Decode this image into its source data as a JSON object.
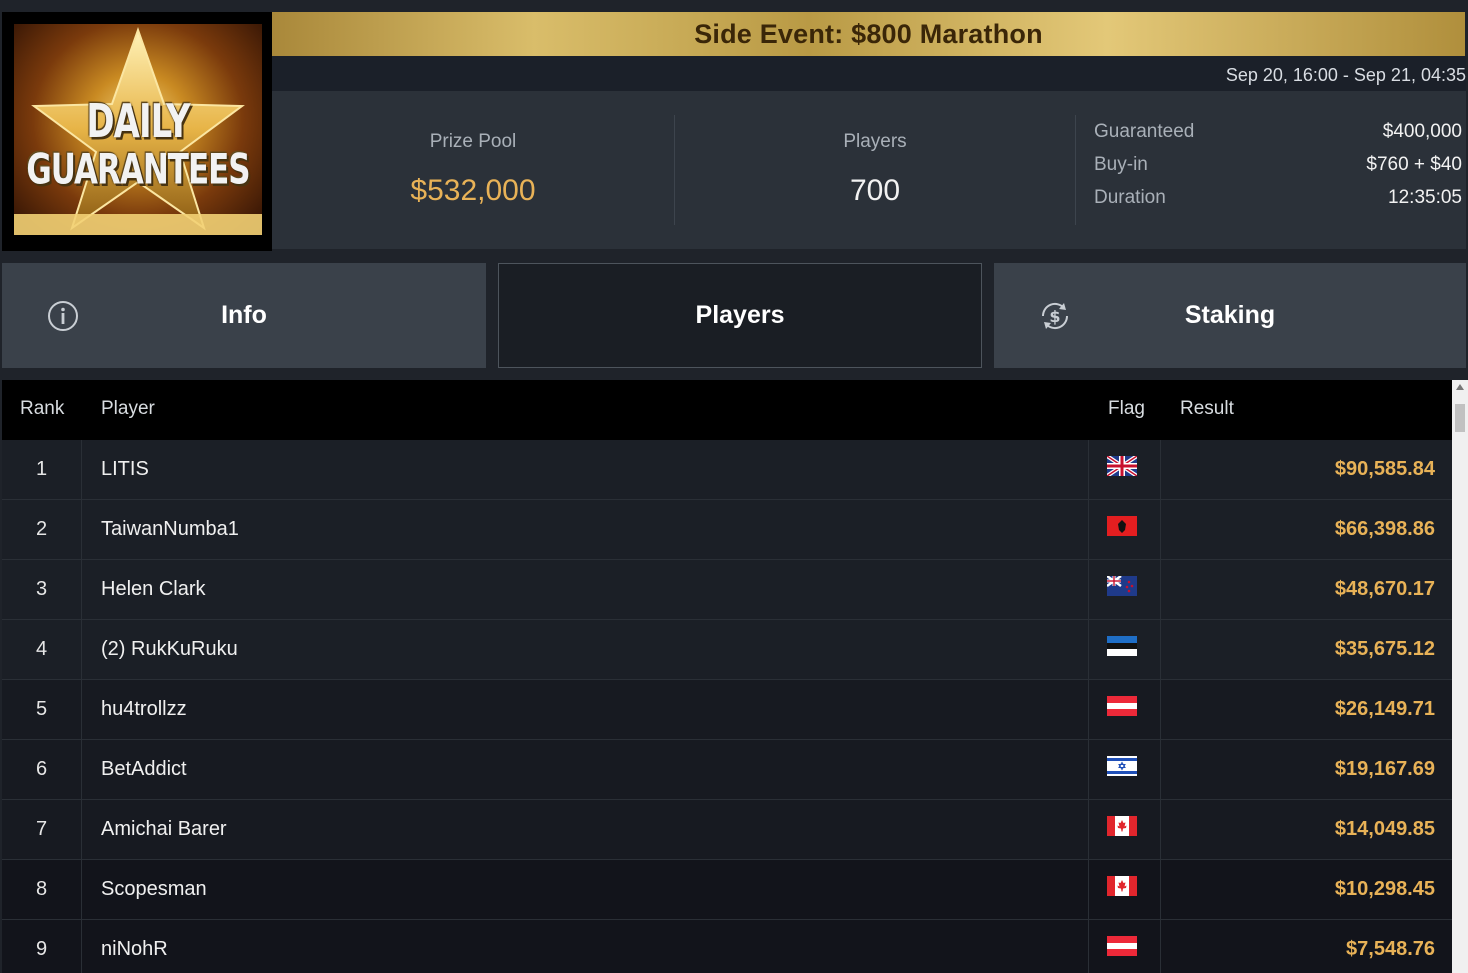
{
  "logo": {
    "line1": "DAILY",
    "line2": "GUARANTEES"
  },
  "event": {
    "title": "Side Event: $800 Marathon",
    "dates": "Sep 20, 16:00 - Sep 21, 04:35"
  },
  "stats": {
    "prize_pool_label": "Prize Pool",
    "prize_pool_value": "$532,000",
    "players_label": "Players",
    "players_value": "700",
    "details": [
      {
        "label": "Guaranteed",
        "value": "$400,000"
      },
      {
        "label": "Buy-in",
        "value": "$760 + $40"
      },
      {
        "label": "Duration",
        "value": "12:35:05"
      }
    ]
  },
  "tabs": [
    {
      "label": "Info",
      "icon": "info-icon",
      "active": false
    },
    {
      "label": "Players",
      "icon": "",
      "active": true
    },
    {
      "label": "Staking",
      "icon": "dollar-cycle-icon",
      "active": false
    }
  ],
  "table": {
    "headers": {
      "rank": "Rank",
      "player": "Player",
      "flag": "Flag",
      "result": "Result"
    },
    "rows": [
      {
        "rank": "1",
        "player": "LITIS",
        "flag": "uk-flag-icon",
        "result": "$90,585.84"
      },
      {
        "rank": "2",
        "player": "TaiwanNumba1",
        "flag": "albania-flag-icon",
        "result": "$66,398.86"
      },
      {
        "rank": "3",
        "player": "Helen Clark",
        "flag": "new-zealand-flag-icon",
        "result": "$48,670.17"
      },
      {
        "rank": "4",
        "player": "(2) RukKuRuku",
        "flag": "estonia-flag-icon",
        "result": "$35,675.12"
      },
      {
        "rank": "5",
        "player": "hu4trollzz",
        "flag": "austria-flag-icon",
        "result": "$26,149.71"
      },
      {
        "rank": "6",
        "player": "BetAddict",
        "flag": "israel-flag-icon",
        "result": "$19,167.69"
      },
      {
        "rank": "7",
        "player": "Amichai Barer",
        "flag": "canada-flag-icon",
        "result": "$14,049.85"
      },
      {
        "rank": "8",
        "player": "Scopesman",
        "flag": "canada-flag-icon",
        "result": "$10,298.45"
      },
      {
        "rank": "9",
        "player": "niNohR",
        "flag": "austria-flag-icon",
        "result": "$7,548.76"
      }
    ]
  },
  "colors": {
    "accent_gold": "#e8b257",
    "title_bar_gold": "#d9bd6a",
    "panel_bg": "#2b3139",
    "tab_bg": "#3a414a",
    "active_tab_bg": "#1a1e24"
  }
}
